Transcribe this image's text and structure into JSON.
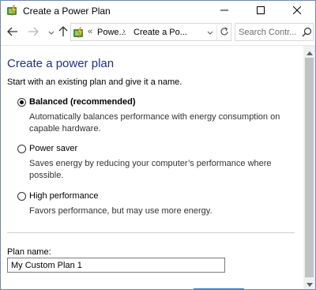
{
  "window": {
    "title": "Create a Power Plan",
    "icons": {
      "app": "power-options-icon",
      "minimize": "minimize-icon",
      "maximize": "maximize-icon",
      "close": "close-icon"
    }
  },
  "navigation": {
    "back_icon": "back-arrow-icon",
    "forward_icon": "forward-arrow-icon",
    "recent_icon": "chevron-down-icon",
    "up_icon": "up-arrow-icon",
    "address": {
      "icon": "power-options-icon",
      "overflow": "«",
      "crumbs": [
        "Powe...",
        "Create a Po..."
      ],
      "separator": "›",
      "dropdown_icon": "chevron-down-icon",
      "refresh_icon": "refresh-icon"
    },
    "search": {
      "placeholder": "Search Contr...",
      "icon": "search-icon"
    }
  },
  "main": {
    "title": "Create a power plan",
    "intro": "Start with an existing plan and give it a name.",
    "options": [
      {
        "label": "Balanced (recommended)",
        "description": "Automatically balances performance with energy consumption on capable hardware.",
        "selected": true
      },
      {
        "label": "Power saver",
        "description": "Saves energy by reducing your computer’s performance where possible.",
        "selected": false
      },
      {
        "label": "High performance",
        "description": "Favors performance, but may use more energy.",
        "selected": false
      }
    ],
    "plan_name_label": "Plan name:",
    "plan_name_value": "My Custom Plan 1"
  },
  "colors": {
    "title": "#1e3287",
    "accent": "#0078d7"
  }
}
